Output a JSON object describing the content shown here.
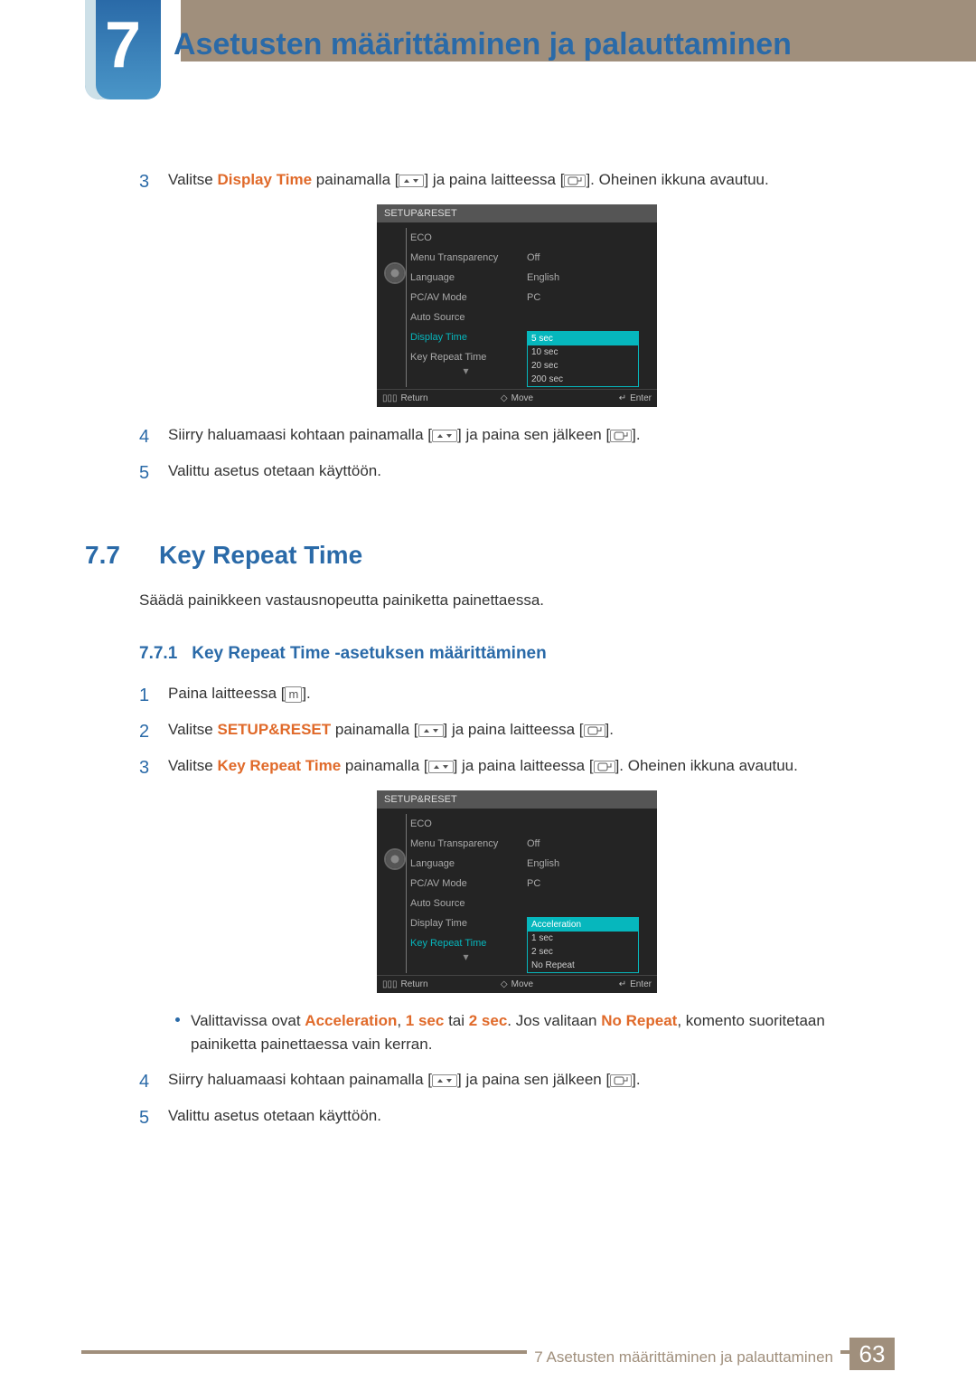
{
  "chapter": {
    "number": "7",
    "title": "Asetusten määrittäminen ja palauttaminen"
  },
  "part1": {
    "step3": {
      "num": "3",
      "t1": "Valitse ",
      "strong": "Display Time",
      "t2": " painamalla [",
      "t3": "] ja paina laitteessa [",
      "t4": "]. Oheinen ikkuna avautuu."
    },
    "step4": {
      "num": "4",
      "t1": "Siirry haluamaasi kohtaan painamalla [",
      "t2": "] ja paina sen jälkeen [",
      "t3": "]."
    },
    "step5": {
      "num": "5",
      "text": "Valittu asetus otetaan käyttöön."
    }
  },
  "osd1": {
    "title": "SETUP&RESET",
    "items": [
      "ECO",
      "Menu Transparency",
      "Language",
      "PC/AV Mode",
      "Auto Source",
      "Display Time",
      "Key Repeat Time"
    ],
    "active_index": 5,
    "values": [
      "",
      "Off",
      "English",
      "PC",
      "",
      "",
      ""
    ],
    "dropdown_after": 4,
    "options": [
      "5 sec",
      "10 sec",
      "20 sec",
      "200 sec"
    ],
    "selected_option_index": 0,
    "footer": {
      "return": "Return",
      "move": "Move",
      "enter": "Enter"
    }
  },
  "section77": {
    "num": "7.7",
    "title": "Key Repeat Time",
    "desc": "Säädä painikkeen vastausnopeutta painiketta painettaessa."
  },
  "sub771": {
    "num": "7.7.1",
    "title": "Key Repeat Time -asetuksen määrittäminen"
  },
  "part2": {
    "step1": {
      "num": "1",
      "t1": "Paina laitteessa [",
      "m": "m",
      "t2": "]."
    },
    "step2": {
      "num": "2",
      "t1": "Valitse ",
      "strong": "SETUP&RESET",
      "t2": " painamalla [",
      "t3": "] ja paina laitteessa [",
      "t4": "]."
    },
    "step3": {
      "num": "3",
      "t1": "Valitse ",
      "strong": "Key Repeat Time",
      "t2": " painamalla [",
      "t3": "] ja paina laitteessa [",
      "t4": "]. Oheinen ikkuna avautuu."
    },
    "bullet": {
      "t1": "Valittavissa ovat ",
      "a": "Acceleration",
      "c1": ", ",
      "b": "1 sec",
      "c2": " tai ",
      "c": "2 sec",
      "t2": ". Jos valitaan ",
      "d": "No Repeat",
      "t3": ", komento suoritetaan painiketta painettaessa vain kerran."
    },
    "step4": {
      "num": "4",
      "t1": "Siirry haluamaasi kohtaan painamalla [",
      "t2": "] ja paina sen jälkeen [",
      "t3": "]."
    },
    "step5": {
      "num": "5",
      "text": "Valittu asetus otetaan käyttöön."
    }
  },
  "osd2": {
    "title": "SETUP&RESET",
    "items": [
      "ECO",
      "Menu Transparency",
      "Language",
      "PC/AV Mode",
      "Auto Source",
      "Display Time",
      "Key Repeat Time"
    ],
    "active_index": 6,
    "values": [
      "",
      "Off",
      "English",
      "PC",
      "",
      "",
      ""
    ],
    "dropdown_after": 4,
    "options": [
      "Acceleration",
      "1 sec",
      "2 sec",
      "No Repeat"
    ],
    "selected_option_index": 0,
    "footer": {
      "return": "Return",
      "move": "Move",
      "enter": "Enter"
    }
  },
  "footer": {
    "label": "7 Asetusten määrittäminen ja palauttaminen",
    "page": "63"
  }
}
